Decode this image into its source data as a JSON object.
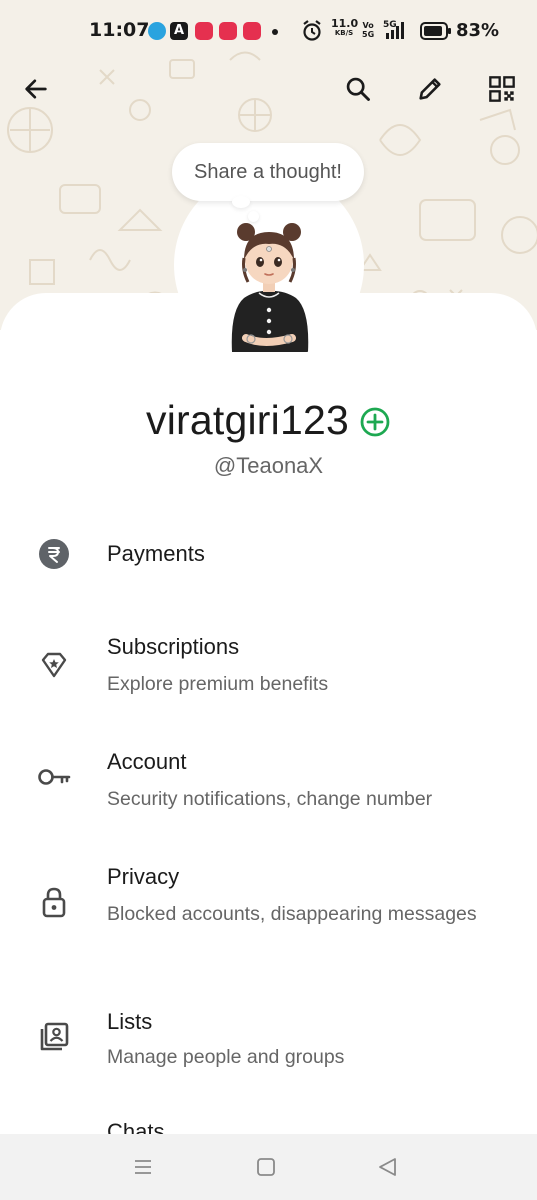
{
  "status_bar": {
    "time": "11:07",
    "speed_value": "11.0",
    "speed_unit": "KB/S",
    "volte_top": "Vo",
    "volte_bottom": "5G",
    "network": "5G",
    "battery": "83%"
  },
  "header": {
    "back_icon": "arrow-left-icon",
    "search_icon": "search-icon",
    "edit_icon": "pencil-icon",
    "qr_icon": "qr-code-icon"
  },
  "profile": {
    "thought_placeholder": "Share a thought!",
    "name": "viratgiri123",
    "username": "@TeaonaX",
    "accent_color": "#1da851"
  },
  "menu": [
    {
      "icon": "rupee-icon",
      "title": "Payments",
      "subtitle": ""
    },
    {
      "icon": "diamond-star-icon",
      "title": "Subscriptions",
      "subtitle": "Explore premium benefits"
    },
    {
      "icon": "key-icon",
      "title": "Account",
      "subtitle": "Security notifications, change number"
    },
    {
      "icon": "lock-icon",
      "title": "Privacy",
      "subtitle": "Blocked accounts, disappearing messages"
    },
    {
      "icon": "contact-list-icon",
      "title": "Lists",
      "subtitle": "Manage people and groups"
    },
    {
      "icon": "chat-icon",
      "title": "Chats",
      "subtitle": ""
    }
  ],
  "nav_bar": {
    "recents_icon": "menu-lines-icon",
    "home_icon": "square-icon",
    "back_icon": "triangle-back-icon"
  }
}
